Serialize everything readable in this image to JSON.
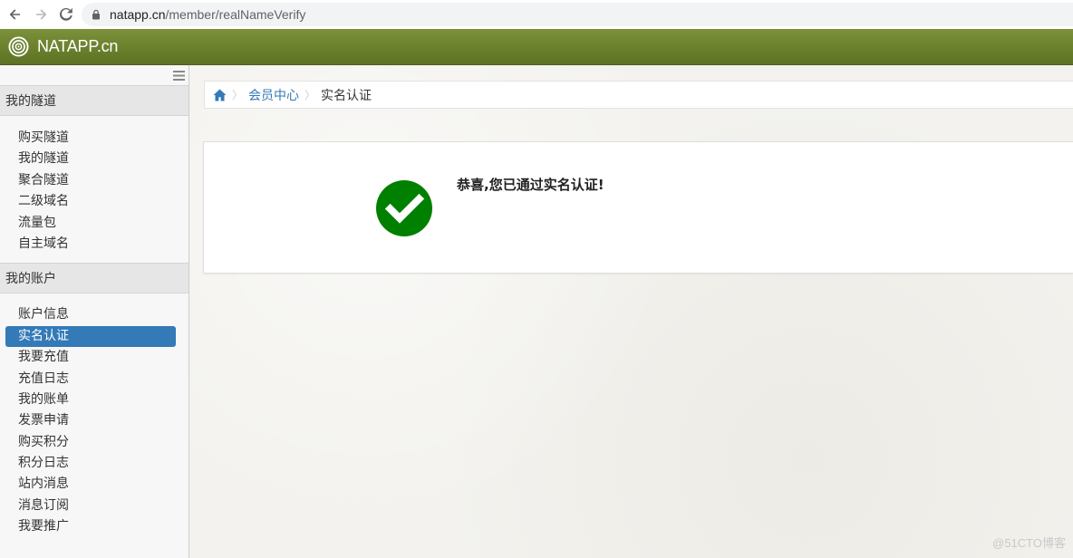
{
  "browser": {
    "url_host": "natapp.cn",
    "url_path": "/member/realNameVerify"
  },
  "header": {
    "site_name": "NATAPP.cn"
  },
  "sidebar": {
    "sections": [
      {
        "title": "我的隧道",
        "items": [
          "购买隧道",
          "我的隧道",
          "聚合隧道",
          "二级域名",
          "流量包",
          "自主域名"
        ]
      },
      {
        "title": "我的账户",
        "items": [
          "账户信息",
          "实名认证",
          "我要充值",
          "充值日志",
          "我的账单",
          "发票申请",
          "购买积分",
          "积分日志",
          "站内消息",
          "消息订阅",
          "我要推广"
        ]
      }
    ],
    "active_item": "实名认证"
  },
  "breadcrumb": {
    "parent": "会员中心",
    "current": "实名认证"
  },
  "result": {
    "message": "恭喜,您已通过实名认证!",
    "status_color": "#008000"
  },
  "colors": {
    "header_green": "#6b8030",
    "link_blue": "#337ab7",
    "active_bg": "#337ab7"
  },
  "watermark": "@51CTO博客"
}
